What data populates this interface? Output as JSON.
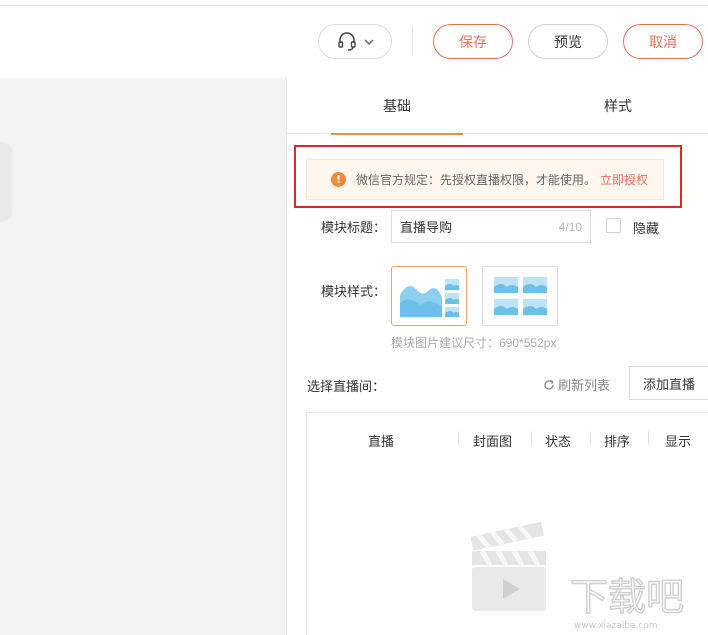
{
  "toolbar": {
    "save_label": "保存",
    "preview_label": "预览",
    "cancel_label": "取消"
  },
  "tabs": [
    {
      "label": "基础",
      "active": true
    },
    {
      "label": "样式",
      "active": false
    }
  ],
  "notice": {
    "text": "微信官方规定：先授权直播权限，才能使用。",
    "link": "立即授权"
  },
  "form": {
    "title_label": "模块标题：",
    "title_value": "直播导购",
    "title_count": "4/10",
    "hide_label": "隐藏",
    "style_label": "模块样式：",
    "size_hint": "模块图片建议尺寸：690*552px",
    "live_label": "选择直播间：",
    "refresh_label": "刷新列表",
    "add_live_label": "添加直播"
  },
  "table": {
    "columns": [
      "直播",
      "封面图",
      "状态",
      "排序",
      "显示"
    ]
  },
  "watermark": {
    "brand": "下载吧",
    "url": "www.xiazaiba.com"
  },
  "icons": {
    "support": "headset-icon",
    "dropdown": "chevron-down-icon",
    "warning": "info-icon",
    "refresh": "refresh-icon",
    "empty": "clapperboard-icon"
  },
  "colors": {
    "accent": "#e8705a",
    "tab_underline": "#f08a3c",
    "highlight_box": "#d92a2a",
    "notice_bg": "#fff7ee"
  }
}
